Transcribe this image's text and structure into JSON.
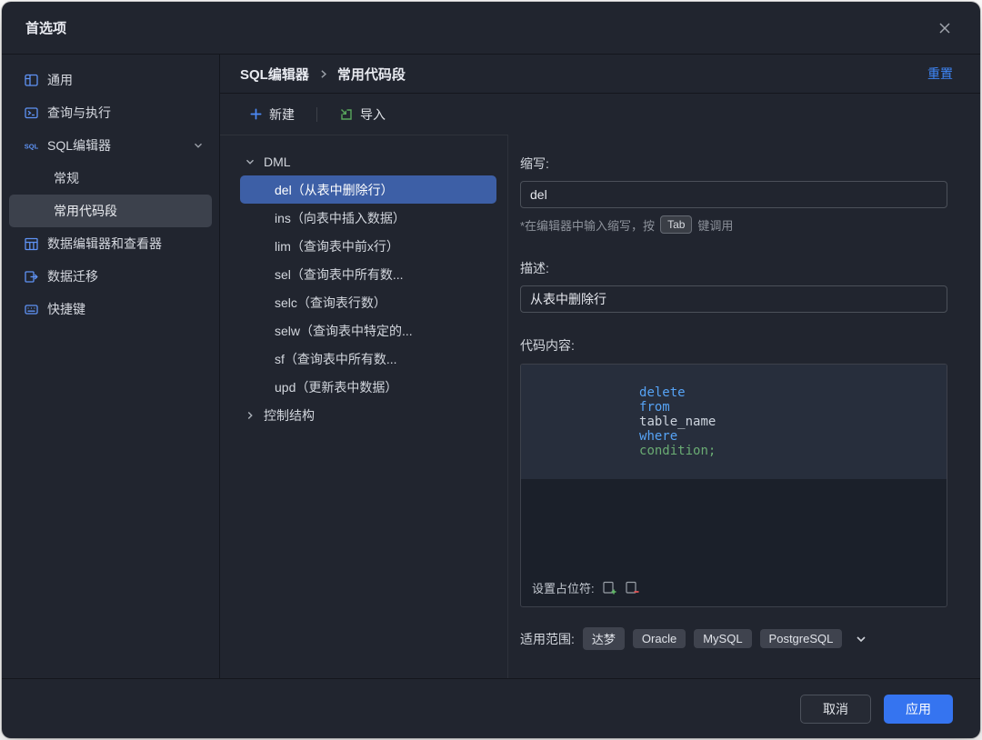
{
  "window": {
    "title": "首选项"
  },
  "sidebar": {
    "items": [
      {
        "label": "通用"
      },
      {
        "label": "查询与执行"
      },
      {
        "label": "SQL编辑器"
      },
      {
        "label": "常规"
      },
      {
        "label": "常用代码段"
      },
      {
        "label": "数据编辑器和查看器"
      },
      {
        "label": "数据迁移"
      },
      {
        "label": "快捷键"
      }
    ]
  },
  "header": {
    "breadcrumb_parent": "SQL编辑器",
    "breadcrumb_current": "常用代码段",
    "reset": "重置"
  },
  "toolbar": {
    "new": "新建",
    "import": "导入"
  },
  "tree": {
    "groups": [
      {
        "label": "DML",
        "items": [
          "del（从表中删除行）",
          "ins（向表中插入数据）",
          "lim（查询表中前x行）",
          "sel（查询表中所有数...",
          "selc（查询表行数）",
          "selw（查询表中特定的...",
          "sf（查询表中所有数...",
          "upd（更新表中数据）"
        ]
      },
      {
        "label": "控制结构",
        "items": []
      }
    ]
  },
  "form": {
    "abbr_label": "缩写:",
    "abbr_value": "del",
    "hint_before": "*在编辑器中输入缩写，按",
    "hint_key": "Tab",
    "hint_after": "键调用",
    "desc_label": "描述:",
    "desc_value": "从表中删除行",
    "code_label": "代码内容:",
    "code_tokens": [
      {
        "t": "delete "
      },
      {
        "t": "from "
      },
      {
        "t": "table_name "
      },
      {
        "t": "where "
      },
      {
        "t": "condition;"
      }
    ],
    "placeholder_label": "设置占位符:",
    "scope_label": "适用范围:",
    "scopes": [
      "达梦",
      "Oracle",
      "MySQL",
      "PostgreSQL"
    ]
  },
  "footer": {
    "cancel": "取消",
    "apply": "应用"
  },
  "colors": {
    "accent": "#3574f0",
    "selection": "#3d5fa6",
    "keyword": "#56a3f5",
    "string": "#6aab73"
  }
}
